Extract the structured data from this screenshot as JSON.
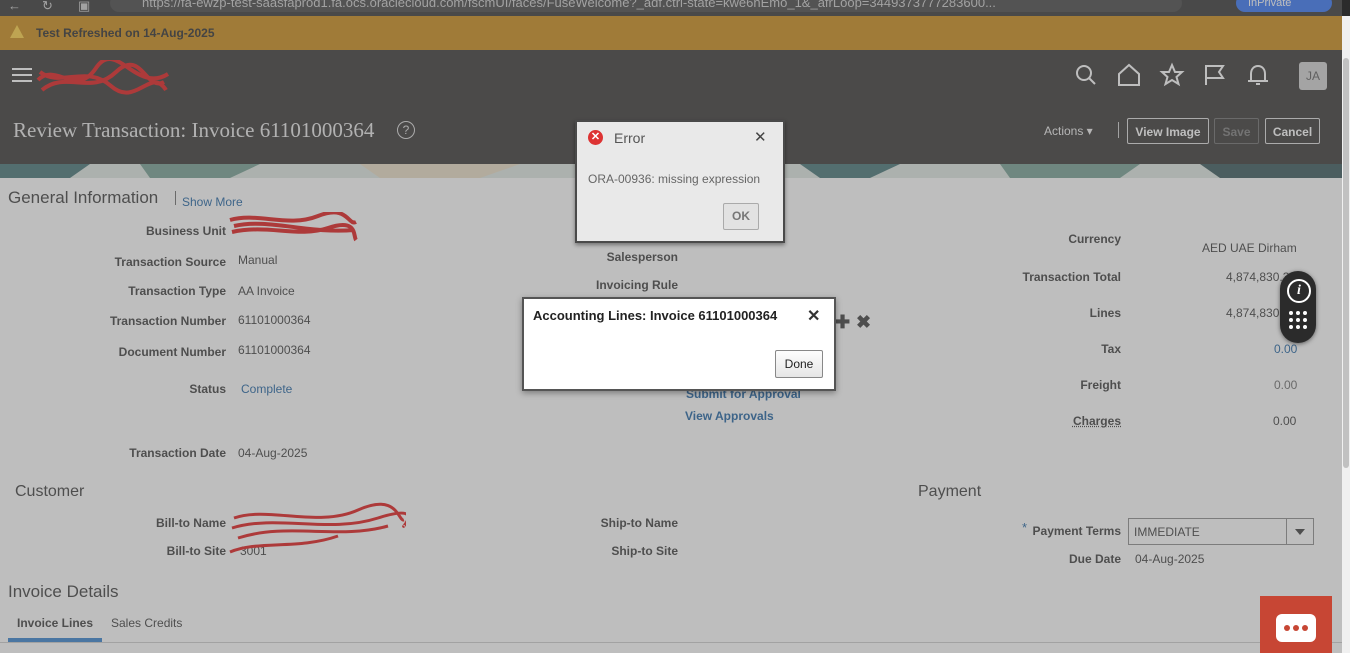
{
  "browser": {
    "url_fragment": "https://fa-ewzp-test-saasfaprod1.fa.ocs.oraclecloud.com/fscmUI/faces/FuseWelcome?_adf.ctrl-state=kwe6nEmo_1&_afrLoop=3449373777283600...",
    "profile_label": "InPrivate"
  },
  "banner": {
    "text": "Test Refreshed on 14-Aug-2025",
    "color": "#c9860b"
  },
  "header": {
    "page_title": "Review Transaction: Invoice 61101000364",
    "help_label": "?",
    "actions_label": "Actions ▾",
    "view_image_label": "View Image",
    "save_label": "Save",
    "cancel_label": "Cancel",
    "avatar_initials": "JA",
    "icons": [
      "search-icon",
      "home-icon",
      "favorites-star-icon",
      "flag-icon",
      "bell-icon"
    ]
  },
  "general": {
    "section_title": "General Information",
    "show_more": "Show More",
    "labels": {
      "business_unit": "Business Unit",
      "transaction_source": "Transaction Source",
      "transaction_type": "Transaction Type",
      "transaction_number": "Transaction Number",
      "document_number": "Document Number",
      "status": "Status",
      "transaction_date": "Transaction Date",
      "salesperson": "Salesperson",
      "invoicing_rule": "Invoicing Rule",
      "currency": "Currency",
      "transaction_total": "Transaction Total",
      "lines": "Lines",
      "tax": "Tax",
      "freight": "Freight",
      "charges": "Charges"
    },
    "values": {
      "transaction_source": "Manual",
      "transaction_type": "AA Invoice",
      "transaction_number": "61101000364",
      "document_number": "61101000364",
      "status": "Complete",
      "transaction_date": "04-Aug-2025",
      "currency": "AED UAE Dirham",
      "transaction_total": "4,874,830.3",
      "lines": "4,874,830",
      "tax": "0.00",
      "freight": "0.00",
      "charges": "0.00"
    },
    "links": {
      "submit_for_approval": "Submit for Approval",
      "view_approvals": "View Approvals"
    }
  },
  "customer": {
    "section_title": "Customer",
    "bill_to_name_label": "Bill-to Name",
    "bill_to_site_label": "Bill-to Site",
    "bill_to_site_value": "3001",
    "ship_to_name_label": "Ship-to Name",
    "ship_to_site_label": "Ship-to Site"
  },
  "payment": {
    "section_title": "Payment",
    "payment_terms_label": "Payment Terms",
    "payment_terms_value": "IMMEDIATE",
    "required_marker": "*",
    "due_date_label": "Due Date",
    "due_date_value": "04-Aug-2025"
  },
  "invoice_details": {
    "section_title": "Invoice Details",
    "tabs": [
      {
        "label": "Invoice Lines",
        "active": true
      },
      {
        "label": "Sales Credits",
        "active": false
      }
    ]
  },
  "error_dialog": {
    "title": "Error",
    "message": "ORA-00936: missing expression",
    "ok_label": "OK",
    "close_label": "✕"
  },
  "accounting_dialog": {
    "title": "Accounting Lines: Invoice 61101000364",
    "done_label": "Done",
    "close_label": "✕"
  },
  "floating": {
    "info_label": "i"
  },
  "colors": {
    "header_bg": "#2f2d2b",
    "link": "#145c9e",
    "accent_red": "#c74634"
  }
}
